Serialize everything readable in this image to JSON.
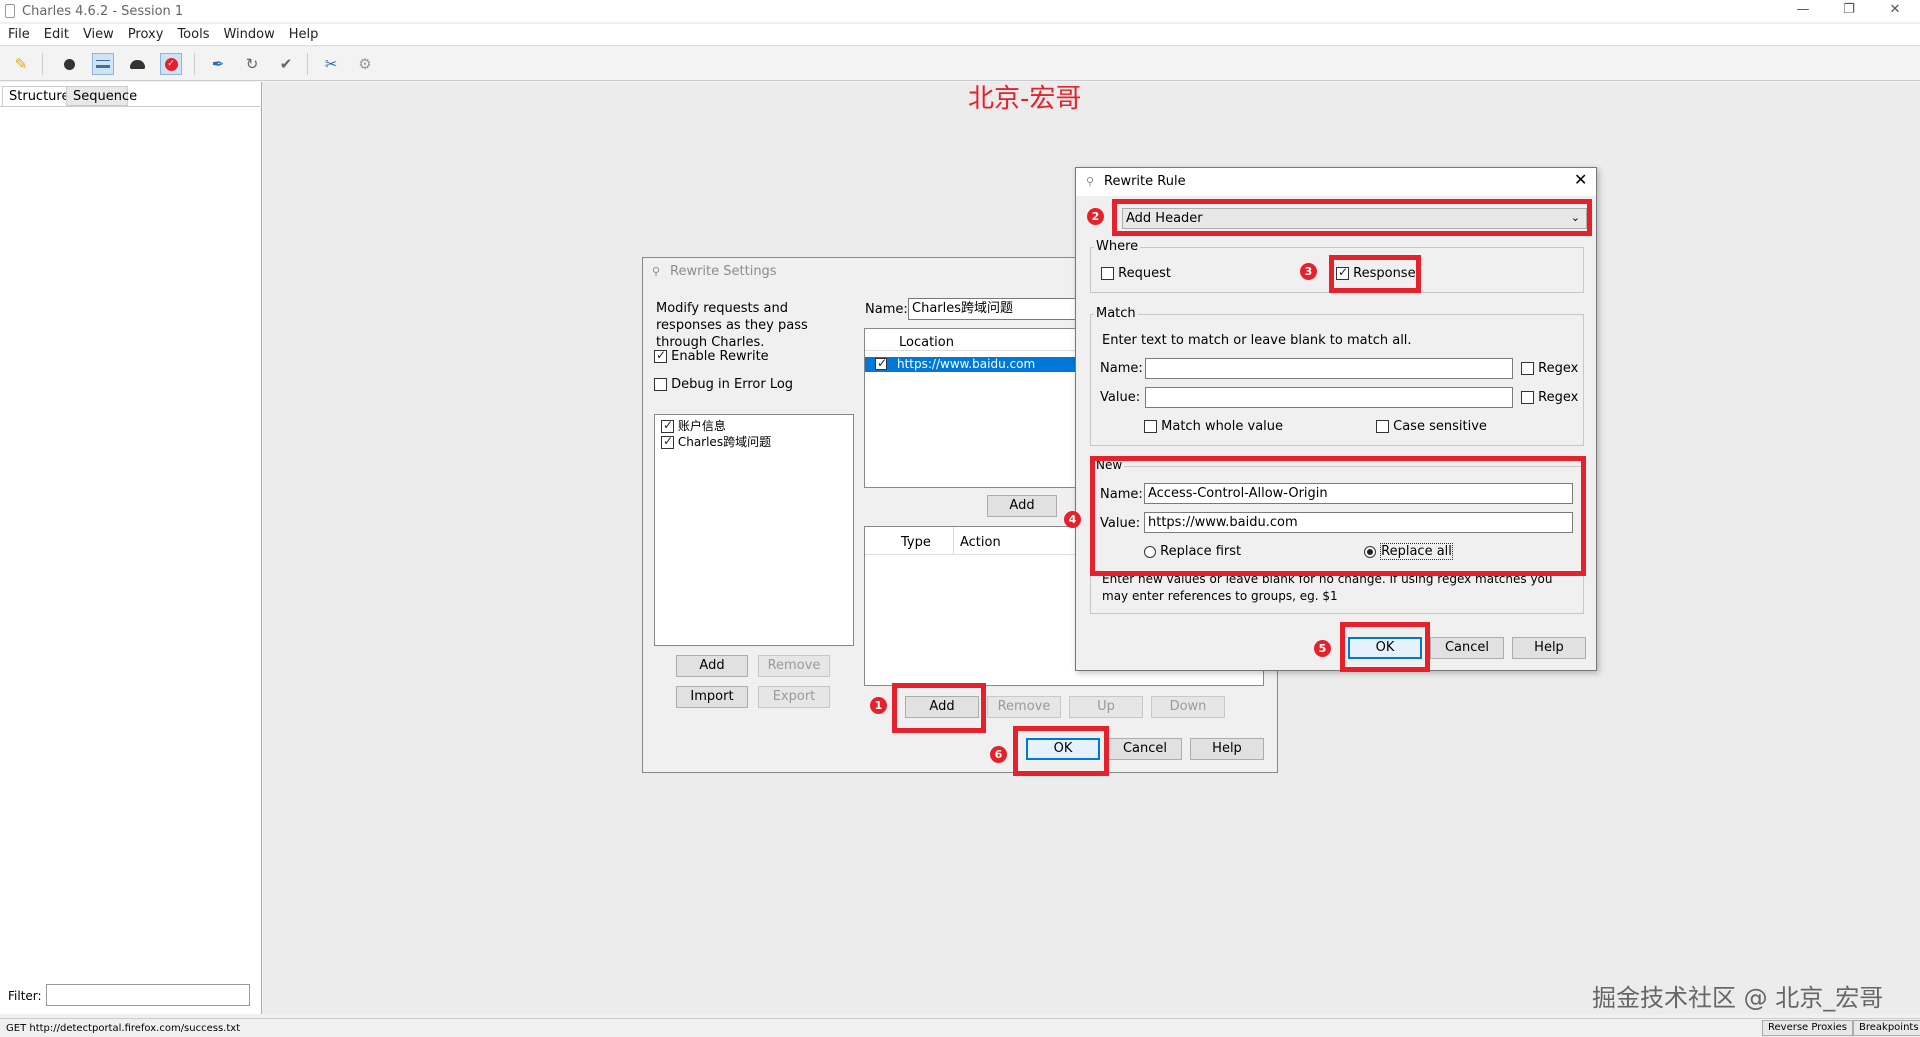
{
  "window": {
    "title": "Charles 4.6.2 - Session 1"
  },
  "menu": [
    "File",
    "Edit",
    "View",
    "Proxy",
    "Tools",
    "Window",
    "Help"
  ],
  "toolbar_icons": [
    "broom-icon",
    "record-icon",
    "throttle-icon",
    "turtle-icon",
    "breakpoint-icon",
    "pen-icon",
    "refresh-icon",
    "check-icon",
    "tools-icon",
    "settings-icon"
  ],
  "tabs": {
    "structure": "Structure",
    "sequence": "Sequence"
  },
  "watermark_top": "北京-宏哥",
  "watermark_bottom": "掘金技术社区 @ 北京_宏哥",
  "filter": {
    "label": "Filter:",
    "value": ""
  },
  "status": {
    "text": "GET http://detectportal.firefox.com/success.txt",
    "reverse_proxies": "Reverse Proxies",
    "breakpoints": "Breakpoints"
  },
  "rewrite_settings": {
    "title": "Rewrite Settings",
    "description": "Modify requests and responses as they pass through Charles.",
    "enable_rewrite": "Enable Rewrite",
    "debug_log": "Debug in Error Log",
    "sets": [
      {
        "label": "账户信息",
        "checked": true
      },
      {
        "label": "Charles跨域问题",
        "checked": true
      }
    ],
    "name_label": "Name:",
    "name_value": "Charles跨域问题",
    "location_header": "Location",
    "locations": [
      "https://www.baidu.com"
    ],
    "type_header": "Type",
    "action_header": "Action",
    "buttons": {
      "add_set": "Add",
      "remove_set": "Remove",
      "import": "Import",
      "export": "Export",
      "add_location": "Add",
      "add_rule": "Add",
      "remove_rule": "Remove",
      "up": "Up",
      "down": "Down",
      "ok": "OK",
      "cancel": "Cancel",
      "help": "Help"
    }
  },
  "rewrite_rule": {
    "title": "Rewrite Rule",
    "type_value": "Add Header",
    "where_label": "Where",
    "request": "Request",
    "response": "Response",
    "match_label": "Match",
    "match_hint": "Enter text to match or leave blank to match all.",
    "name_label": "Name:",
    "value_label": "Value:",
    "regex": "Regex",
    "match_whole": "Match whole value",
    "case_sensitive": "Case sensitive",
    "new_label": "New",
    "new_name": "Access-Control-Allow-Origin",
    "new_value": "https://www.baidu.com",
    "replace_first": "Replace first",
    "replace_all": "Replace all",
    "new_hint": "Enter new values or leave blank for no change. If using regex matches you may enter references to groups, eg. $1",
    "ok": "OK",
    "cancel": "Cancel",
    "help": "Help"
  },
  "step_badges": [
    "1",
    "2",
    "3",
    "4",
    "5",
    "6"
  ],
  "colors": {
    "annotation_red": "#e5212b",
    "selection_blue": "#0078d7"
  }
}
